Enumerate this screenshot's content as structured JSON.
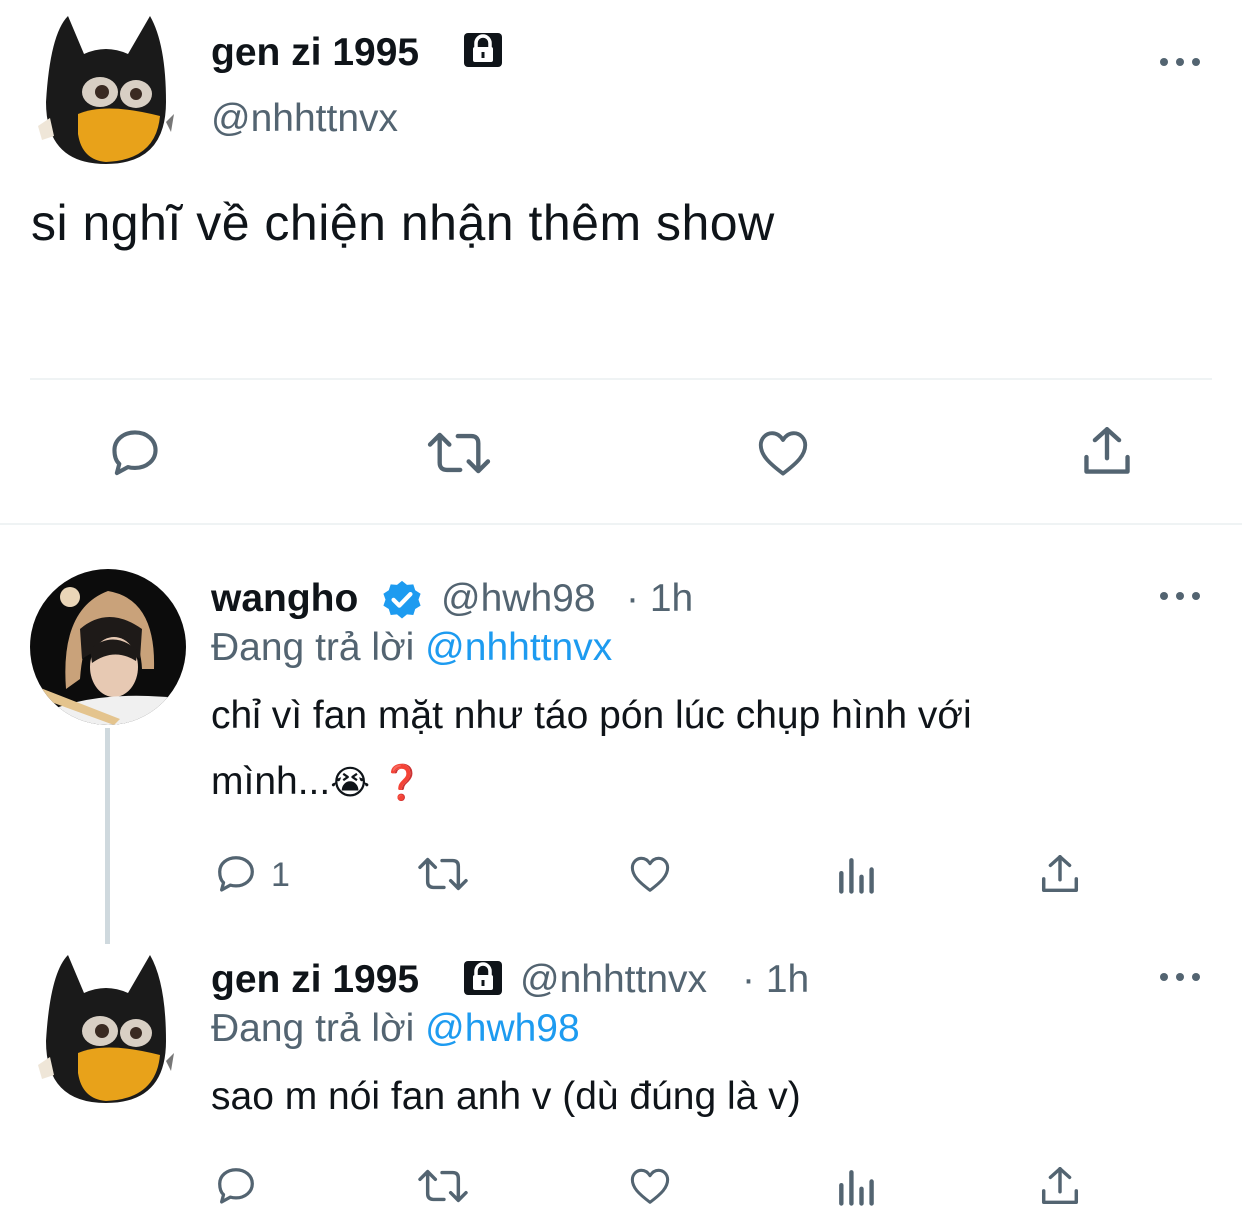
{
  "main_tweet": {
    "display_name": "gen zi 1995",
    "handle": "@nhhttnvx",
    "text": "si nghĩ về chiện nhận thêm show"
  },
  "reply1": {
    "display_name": "wangho",
    "handle": "@hwh98",
    "time": "· 1h",
    "replying_prefix": "Đang trả lời",
    "replying_to": "@nhhttnvx",
    "text_line1": "chỉ vì fan mặt như táo pón lúc chụp hình với",
    "text_line2": "mình...",
    "emoji1": "😭",
    "emoji2": "❓",
    "reply_count": "1"
  },
  "reply2": {
    "display_name": "gen zi 1995",
    "handle": "@nhhttnvx",
    "time": "· 1h",
    "replying_prefix": "Đang trả lời",
    "replying_to": "@hwh98",
    "text": "sao m nói fan anh v (dù đúng là v)"
  },
  "colors": {
    "text": "#0f1419",
    "secondary": "#536471",
    "accent": "#1d9bf0",
    "divider": "#eff3f4",
    "thread_line": "#cfd9de"
  },
  "icons": [
    "lock-icon",
    "verified-icon",
    "more-icon",
    "reply-icon",
    "retweet-icon",
    "like-icon",
    "share-icon",
    "analytics-icon"
  ]
}
